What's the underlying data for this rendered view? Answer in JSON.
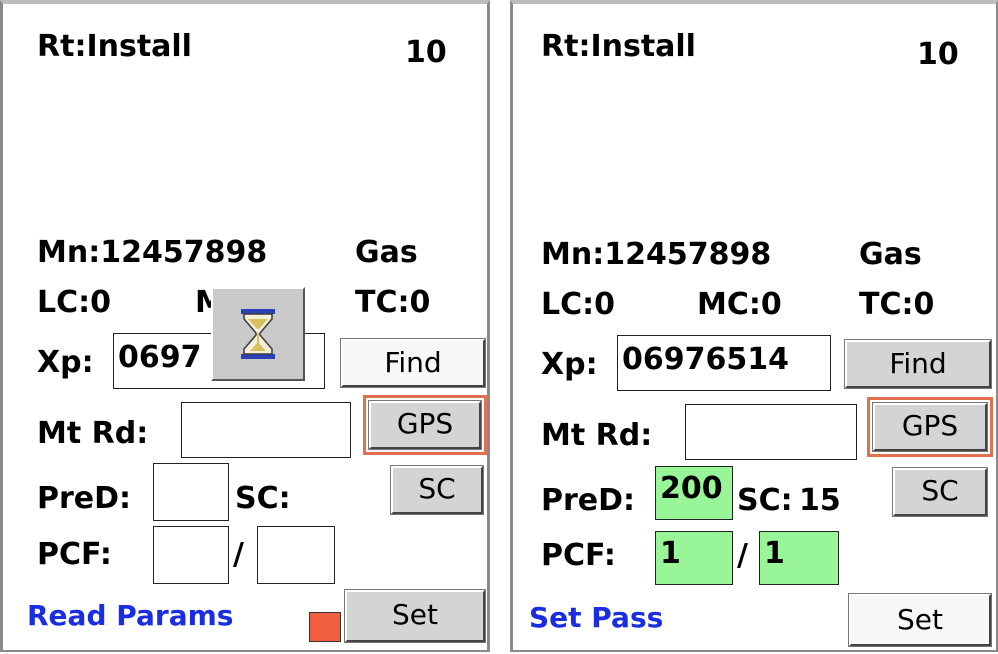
{
  "left": {
    "route": "Rt:Install",
    "count": "10",
    "meter_number": "Mn:12457898",
    "utility": "Gas",
    "lc": "LC:0",
    "mc_partial": "M",
    "tc": "TC:0",
    "xp_label": "Xp:",
    "xp_value": "0697",
    "find_label": "Find",
    "mtrd_label": "Mt Rd:",
    "mtrd_value": "",
    "gps_label": "GPS",
    "pred_label": "PreD:",
    "pred_value": "",
    "sc_label": "SC:",
    "sc_value": "",
    "sc_button": "SC",
    "pcf_label": "PCF:",
    "pcf_a": "",
    "slash": "/",
    "pcf_b": "",
    "status": "Read Params",
    "indicator_color": "#f06040",
    "set_label": "Set",
    "busy_icon": "hourglass-icon"
  },
  "right": {
    "route": "Rt:Install",
    "count": "10",
    "meter_number": "Mn:12457898",
    "utility": "Gas",
    "lc": "LC:0",
    "mc": "MC:0",
    "tc": "TC:0",
    "xp_label": "Xp:",
    "xp_value": "06976514",
    "find_label": "Find",
    "mtrd_label": "Mt Rd:",
    "mtrd_value": "",
    "gps_label": "GPS",
    "pred_label": "PreD:",
    "pred_value": "200",
    "sc_label": "SC:",
    "sc_value": "15",
    "sc_button": "SC",
    "pcf_label": "PCF:",
    "pcf_a": "1",
    "slash": "/",
    "pcf_b": "1",
    "status": "Set Pass",
    "set_label": "Set"
  },
  "colors": {
    "status_text": "#1a2de0",
    "ring": "#e07050",
    "filled_field": "#98f598"
  }
}
